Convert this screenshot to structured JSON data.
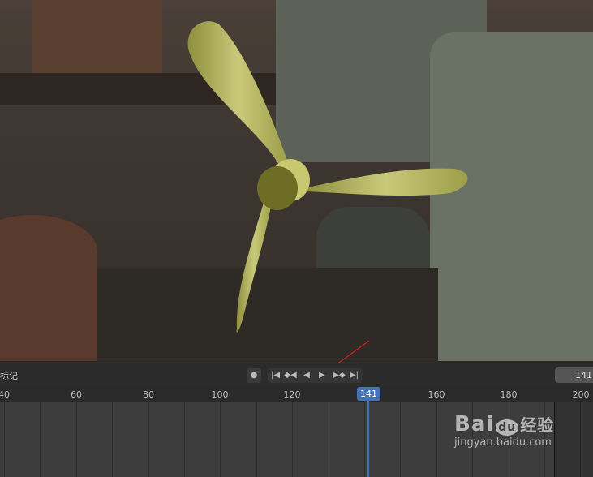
{
  "timeline": {
    "markers_label": "标记",
    "current_frame": "141",
    "frame_labels": [
      "40",
      "60",
      "80",
      "100",
      "120",
      "160",
      "180",
      "200"
    ],
    "controls": {
      "record": "●",
      "jump_start": "|◀",
      "prev_key": "◆◀",
      "play_reverse": "◀",
      "play": "▶",
      "next_key": "▶◆",
      "jump_end": "▶|"
    }
  },
  "watermark": {
    "brand": "Bai du 经验",
    "url": "jingyan.baidu.com"
  },
  "colors": {
    "accent": "#4772b3",
    "propeller": "#b5b660",
    "annotation_arrow": "#d42020"
  }
}
